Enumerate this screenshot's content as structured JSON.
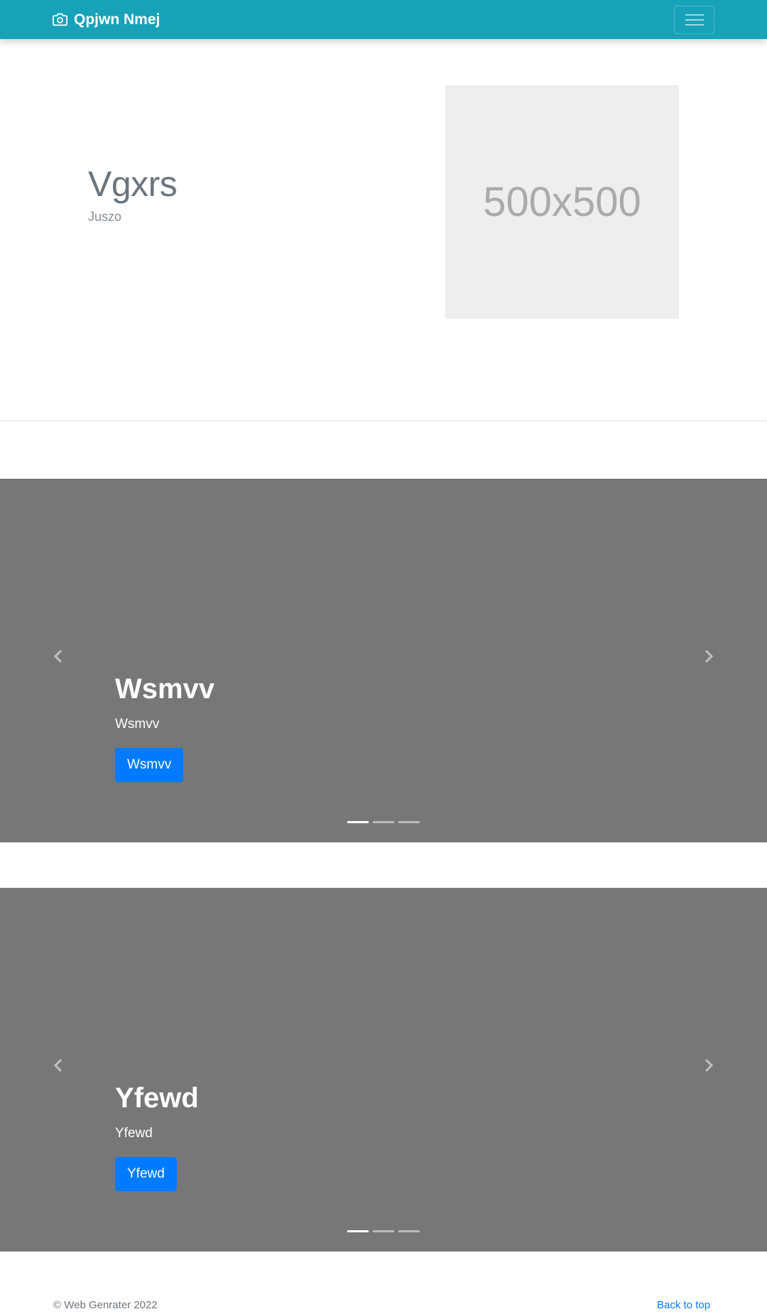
{
  "navbar": {
    "brand_icon": "camera-icon",
    "brand_text": "Qpjwn Nmej",
    "toggler_icon": "hamburger-menu-icon",
    "background": "#17a2b8"
  },
  "hero": {
    "title": "Vgxrs",
    "subtitle": "Juszo",
    "placeholder_text": "500x500"
  },
  "carousels": [
    {
      "caption_title": "Wsmvv",
      "caption_text": "Wsmvv",
      "button_label": "Wsmvv",
      "prev_icon": "chevron-left-icon",
      "next_icon": "chevron-right-icon",
      "indicators": 3,
      "active_indicator": 1
    },
    {
      "caption_title": "Yfewd",
      "caption_text": "Yfewd",
      "button_label": "Yfewd",
      "prev_icon": "chevron-left-icon",
      "next_icon": "chevron-right-icon",
      "indicators": 3,
      "active_indicator": 1
    }
  ],
  "footer": {
    "copyright": "© Web Genrater 2022",
    "back_to_top": "Back to top"
  },
  "colors": {
    "primary": "#007bff",
    "carousel_bg": "#777777",
    "placeholder_bg": "#eeeeee"
  }
}
